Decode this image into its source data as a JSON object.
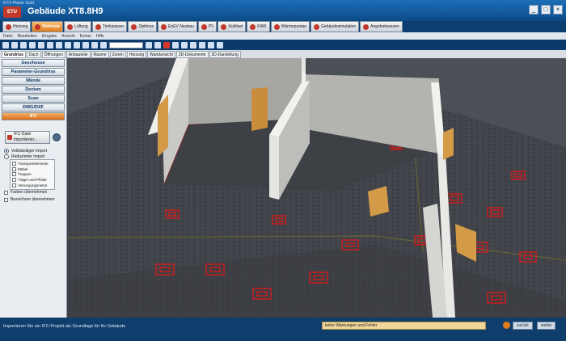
{
  "window": {
    "app_small_title": "ETU-Planer Gold",
    "logo_text": "ETU",
    "document_title": "Gebäude XT8.8H9",
    "controls": [
      "_",
      "□",
      "×"
    ]
  },
  "module_tabs": [
    {
      "label": "Heizung",
      "active": false
    },
    {
      "label": "Rohrnetz",
      "active": true
    },
    {
      "label": "Lüftung",
      "active": false
    },
    {
      "label": "Trinkwasser",
      "active": false
    },
    {
      "label": "Optimus",
      "active": false
    },
    {
      "label": "EnEV Neubau",
      "active": false
    },
    {
      "label": "PV",
      "active": false
    },
    {
      "label": "Kühllast",
      "active": false
    },
    {
      "label": "KWK",
      "active": false
    },
    {
      "label": "Wärmepumpe",
      "active": false
    },
    {
      "label": "Gebäudesimulation",
      "active": false
    },
    {
      "label": "Angebotswesen",
      "active": false
    }
  ],
  "menu": [
    "Datei",
    "Bearbeiten",
    "Eingabe",
    "Ansicht",
    "Extras",
    "Hilfe"
  ],
  "view_tabs": [
    {
      "label": "Grundriss",
      "active": true
    },
    {
      "label": "Dach",
      "active": false
    },
    {
      "label": "Öffnungen",
      "active": false
    },
    {
      "label": "Anbauteile",
      "active": false
    },
    {
      "label": "Räume",
      "active": false
    },
    {
      "label": "Zonen",
      "active": false
    },
    {
      "label": "Heizung",
      "active": false
    },
    {
      "label": "Wandansicht",
      "active": false
    },
    {
      "label": "2D-Dokumente",
      "active": false
    },
    {
      "label": "3D-Darstellung",
      "active": false
    }
  ],
  "sidebar": {
    "sections": [
      {
        "label": "Geschosse",
        "active": false
      },
      {
        "label": "Parameter-Grundriss",
        "active": false
      },
      {
        "label": "Wände",
        "active": false
      },
      {
        "label": "Decken",
        "active": false
      },
      {
        "label": "Scan",
        "active": false
      },
      {
        "label": "DWG/DXF",
        "active": false
      },
      {
        "label": "IFC",
        "active": true
      }
    ],
    "import_button_line1": "IFC-Datei",
    "import_button_line2": "importieren...",
    "radio_full": "Vollständiger Import",
    "radio_reduced": "Reduzierter Import",
    "filters": [
      {
        "label": "Transportelemente",
        "checked": false
      },
      {
        "label": "Möbel",
        "checked": false
      },
      {
        "label": "Treppen",
        "checked": false
      },
      {
        "label": "Träger und Pfeiler",
        "checked": false
      },
      {
        "label": "Versorgungsnetze",
        "checked": false
      }
    ],
    "colors_label": "Farben übernehmen",
    "names_label": "Bezeichner übernehmen"
  },
  "status": {
    "hint": "Importieren Sie ein IFC-Projekt als Grundlage für Ihr Gebäude",
    "message": "keine Warnungen und Fehler",
    "back_label": "zurück",
    "next_label": "weiter"
  },
  "colors": {
    "accent": "#e07b1a",
    "brand": "#0b4a86",
    "floor_heating_pipe": "#c81e1e",
    "wall": "#e9e9e6",
    "floor": "#3f4248"
  }
}
